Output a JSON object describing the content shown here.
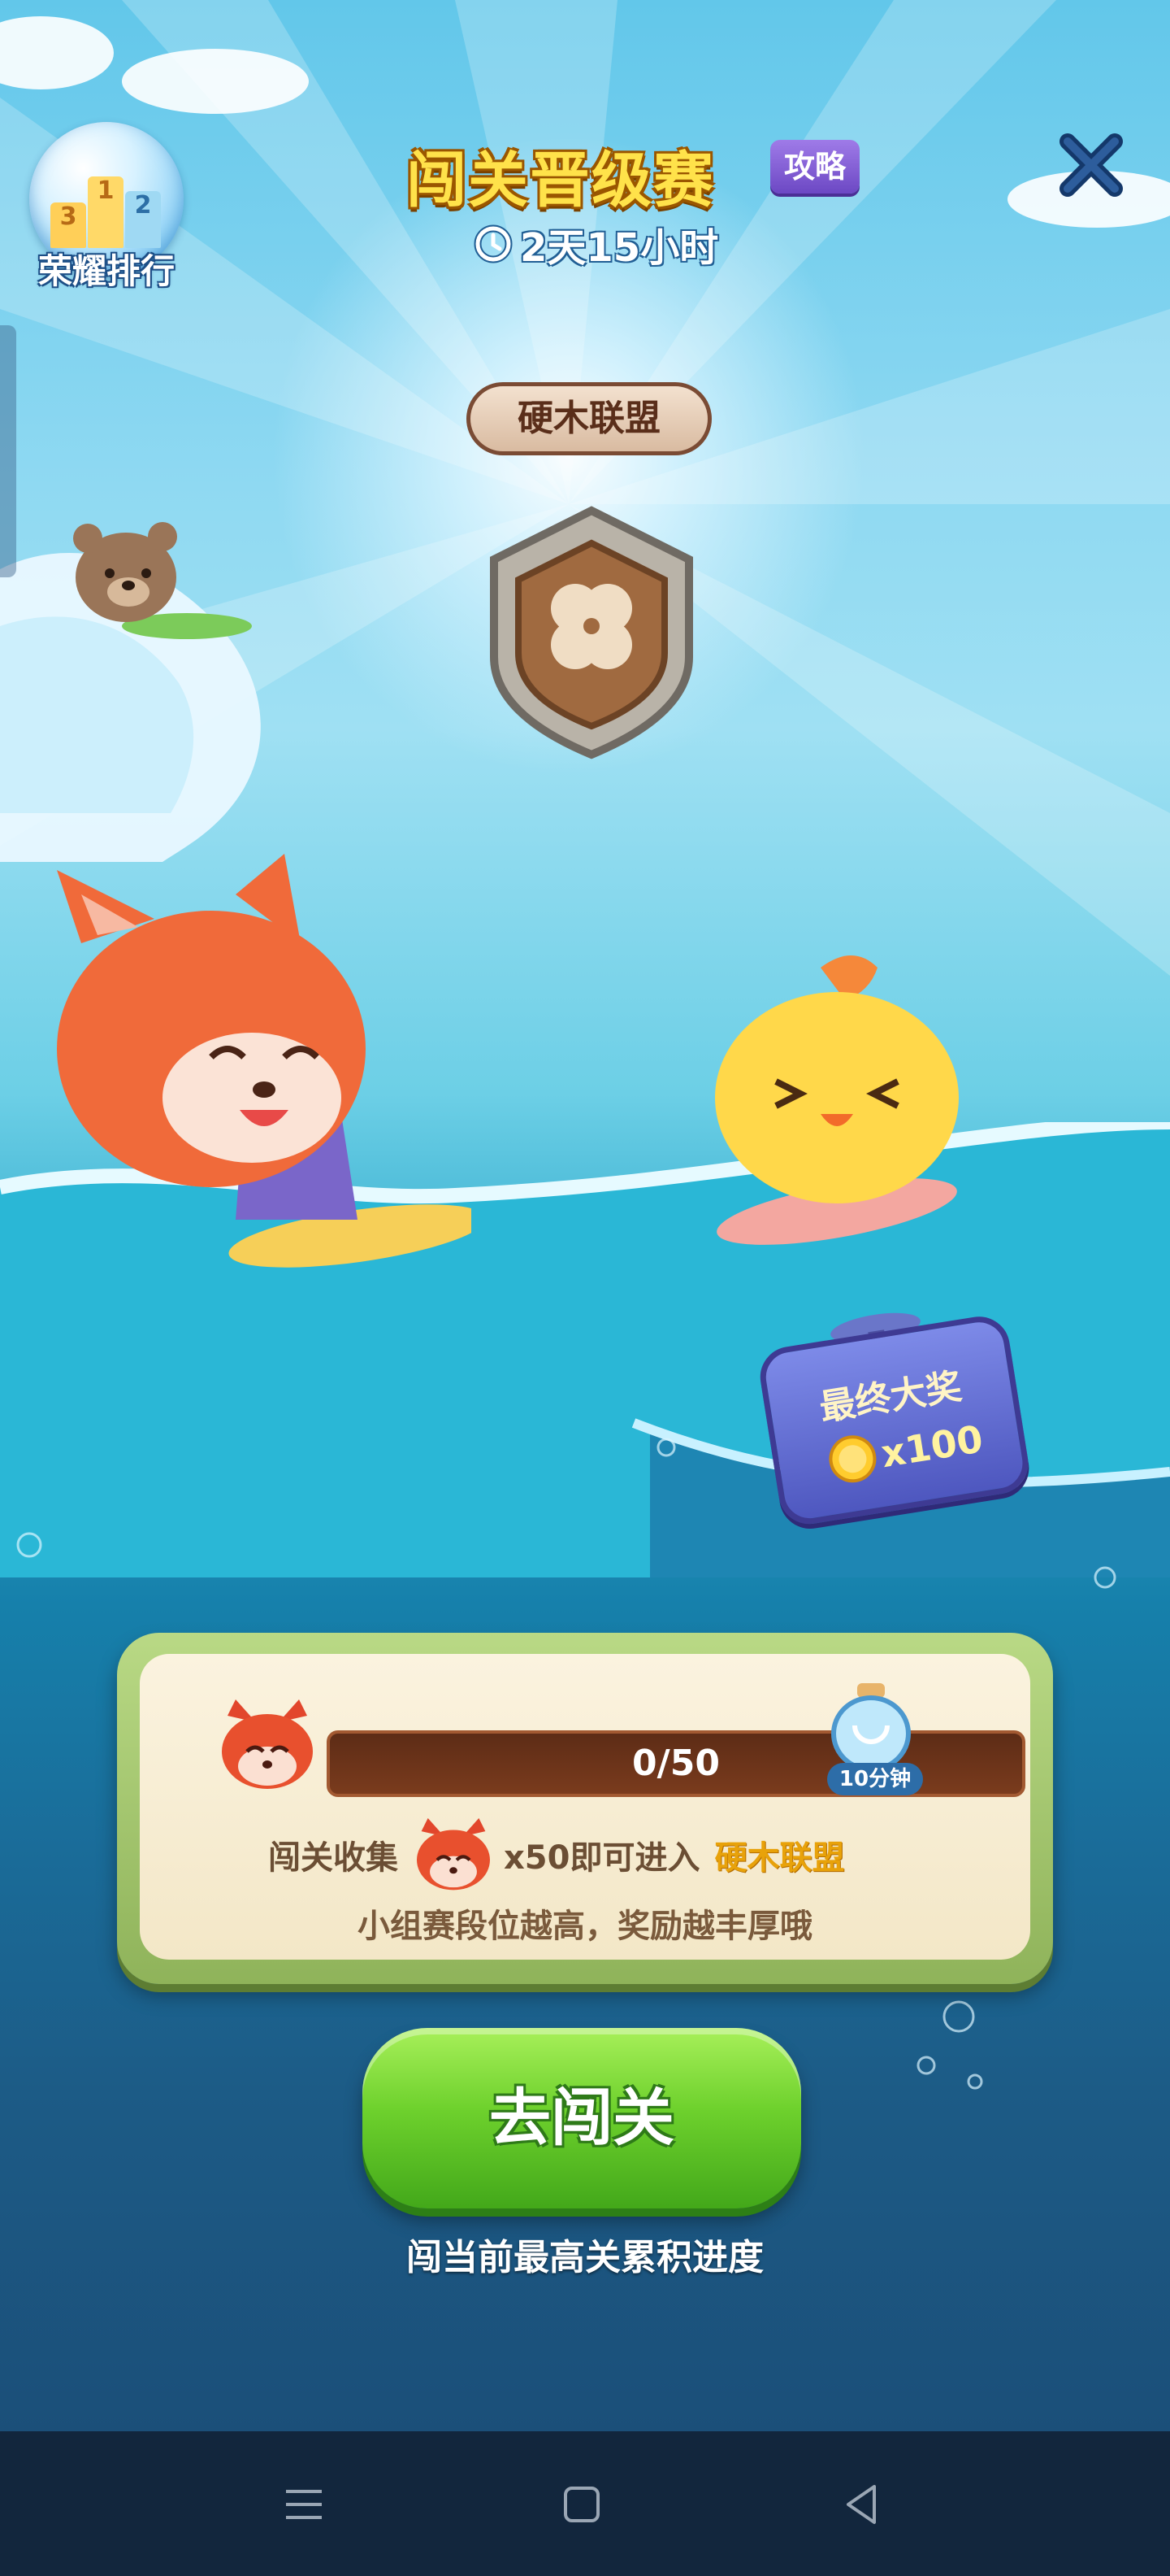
{
  "event": {
    "title": "闯关晋级赛",
    "guide_label": "攻略",
    "timer": "2天15小时"
  },
  "ranking": {
    "label": "荣耀排行",
    "podium": [
      "3",
      "1",
      "2"
    ]
  },
  "league": {
    "name": "硬木联盟"
  },
  "final_prize": {
    "title": "最终大奖",
    "amount": "x100"
  },
  "progress": {
    "text": "0/50",
    "current": 0,
    "target": 50,
    "boost_label": "10分钟"
  },
  "collect": {
    "prefix": "闯关收集",
    "amount": "x50即可进入",
    "league": "硬木联盟",
    "hint": "小组赛段位越高，奖励越丰厚哦"
  },
  "play_button": {
    "label": "去闯关"
  },
  "caption": "闯当前最高关累积进度",
  "colors": {
    "title": "#ffe24a",
    "button": "#6ed12d",
    "league_highlight": "#e8a20a"
  }
}
